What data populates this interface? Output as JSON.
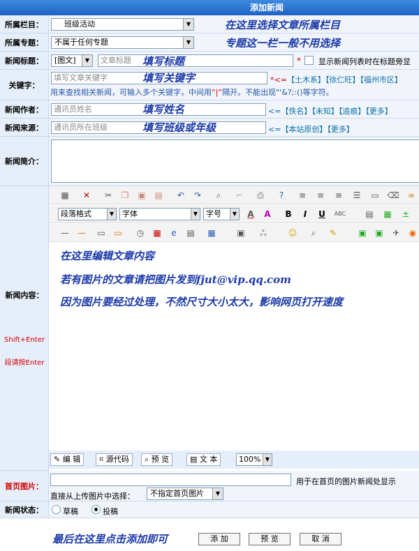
{
  "title": "添加新闻",
  "column": {
    "label": "所属栏目：",
    "value": "班级活动",
    "hint": "在这里选择文章所属栏目"
  },
  "topic": {
    "label": "所属专题：",
    "value": "不属于任何专题",
    "hint": "专题这一栏一般不用选择"
  },
  "headline": {
    "label": "新闻标题：",
    "type_value": "[图文]",
    "placeholder": "文章标题",
    "hint": "填写标题",
    "required": "*",
    "option_label": "显示新闻列表时在标题旁显"
  },
  "keywords": {
    "label": "关键字：",
    "placeholder": "填写文章关键字",
    "hint": "填写关键字",
    "arrow": "*<=",
    "links": [
      "【土木系】",
      "【徐仁旺】",
      "【福州市区】"
    ],
    "help_prefix": "用来查找相关新闻，可输入多个关键字，中间用",
    "help_sep": "“|”",
    "help_suffix": "隔开。不能出现\"'&?;:()等字符。"
  },
  "author": {
    "label": "新闻作者：",
    "placeholder": "通讯员姓名",
    "hint": "填写姓名",
    "arrow": "<=",
    "links": [
      "【佚名】",
      "【未知】",
      "【追痕】",
      "【更多】"
    ]
  },
  "source": {
    "label": "新闻来源：",
    "placeholder": "通讯员所在班级",
    "hint": "填写班级或年级",
    "arrow": "<=",
    "links": [
      "【本站原创】",
      "【更多】"
    ]
  },
  "summary": {
    "label": "新闻简介："
  },
  "content": {
    "label": "新闻内容：",
    "shortcut_1": "Shift+Enter",
    "shortcut_2": "段请按Enter",
    "format_select": "段落格式",
    "font_select": "字体",
    "size_select": "字号",
    "lines": [
      "在这里编辑文章内容",
      "若有图片的文章请把图片发到fjut@vip.qq.com",
      "因为图片要经过处理，不然尺寸大小太大，影响网页打开速度"
    ],
    "modes": [
      "编 辑",
      "源代码",
      "预 览",
      "文 本"
    ],
    "zoom": "100%"
  },
  "home_image": {
    "label": "首页图片：",
    "hint": "用于在首页的图片新闻处显示",
    "upload_label": "直接从上传图片中选择：",
    "select_value": "不指定首页图片"
  },
  "status": {
    "label": "新闻状态：",
    "draft": "草稿",
    "submit": "投稿"
  },
  "footer": {
    "hint": "最后在这里点击添加即可",
    "add": "添 加",
    "preview": "预 览",
    "cancel": "取 消"
  }
}
